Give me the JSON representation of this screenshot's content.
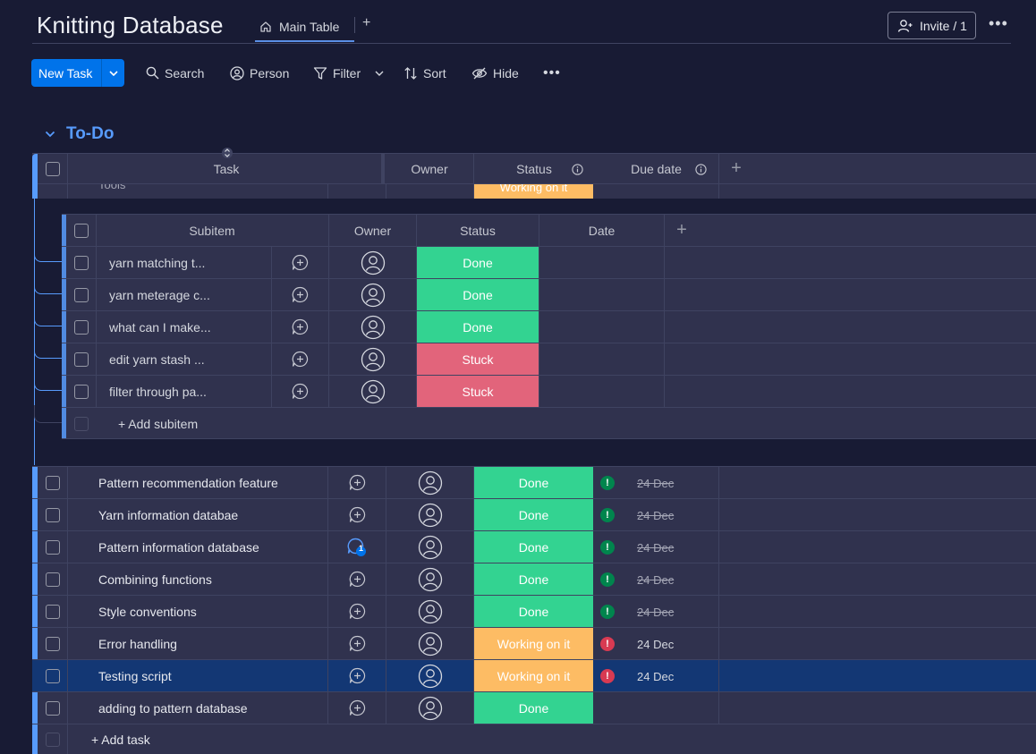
{
  "app": {
    "title": "Knitting Database"
  },
  "tabs": [
    {
      "label": "Main Table"
    }
  ],
  "tab_add": "+",
  "invite": {
    "label": "Invite / 1"
  },
  "toolbar": {
    "new_task": "New Task",
    "search": "Search",
    "person": "Person",
    "filter": "Filter",
    "sort": "Sort",
    "hide": "Hide"
  },
  "group": {
    "title": "To-Do"
  },
  "columns": {
    "task": "Task",
    "owner": "Owner",
    "status": "Status",
    "due_date": "Due date",
    "add": "+"
  },
  "peek_row": {
    "name": "Tools",
    "status": "Working on it"
  },
  "subitems": {
    "columns": {
      "subitem": "Subitem",
      "owner": "Owner",
      "status": "Status",
      "date": "Date",
      "add": "+"
    },
    "rows": [
      {
        "name": "yarn matching t...",
        "status": "Done",
        "kind": "done"
      },
      {
        "name": "yarn meterage c...",
        "status": "Done",
        "kind": "done"
      },
      {
        "name": "what can I make...",
        "status": "Done",
        "kind": "done"
      },
      {
        "name": "edit yarn stash ...",
        "status": "Stuck",
        "kind": "stuck"
      },
      {
        "name": "filter through pa...",
        "status": "Stuck",
        "kind": "stuck"
      }
    ],
    "add_label": "+ Add subitem"
  },
  "tasks": [
    {
      "name": "Pattern recommendation feature",
      "status": "Done",
      "kind": "done",
      "date": "24 Dec",
      "overdue": false,
      "has_date": true
    },
    {
      "name": "Yarn information databae",
      "status": "Done",
      "kind": "done",
      "date": "24 Dec",
      "overdue": false,
      "has_date": true
    },
    {
      "name": "Pattern information database",
      "status": "Done",
      "kind": "done",
      "date": "24 Dec",
      "overdue": false,
      "has_date": true,
      "updates": "1"
    },
    {
      "name": "Combining functions",
      "status": "Done",
      "kind": "done",
      "date": "24 Dec",
      "overdue": false,
      "has_date": true
    },
    {
      "name": "Style conventions",
      "status": "Done",
      "kind": "done",
      "date": "24 Dec",
      "overdue": false,
      "has_date": true
    },
    {
      "name": "Error handling",
      "status": "Working on it",
      "kind": "working",
      "date": "24 Dec",
      "overdue": true,
      "has_date": true
    },
    {
      "name": "Testing script",
      "status": "Working on it",
      "kind": "working",
      "date": "24 Dec",
      "overdue": true,
      "has_date": true,
      "selected": true
    },
    {
      "name": "adding to pattern database",
      "status": "Done",
      "kind": "done",
      "date": "",
      "overdue": false,
      "has_date": false
    }
  ],
  "add_task_label": "+ Add task",
  "colors": {
    "accent": "#579bfc",
    "done": "#33d391",
    "stuck": "#e2647b",
    "working": "#fdbc64",
    "primary": "#0073ea",
    "selected_row": "#133774"
  }
}
